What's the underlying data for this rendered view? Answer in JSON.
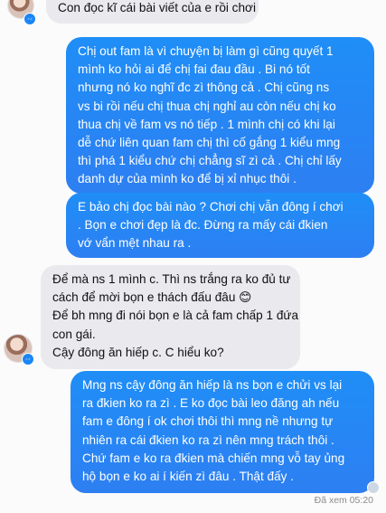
{
  "messages": [
    {
      "sender": "them",
      "lines": [
        "Con đọc kĩ cái bài viết của e rồi chơi"
      ]
    },
    {
      "sender": "me",
      "lines": [
        "Chị out fam là vì chuyện bị làm gì cũng quyết 1",
        "mình ko hỏi ai để chị fai đau đầu . Bi nó tốt",
        "nhưng nó ko nghĩ đc zì thông cả . Chị cũng ns",
        "vs bi rồi nếu chị thua chị nghỉ au còn nếu chị ko",
        "thua chị về fam vs nó tiếp . 1 mình chị có khi lại",
        "dễ chứ liên quan fam chị thì cố gắng 1 kiểu mng",
        "thì phá 1 kiểu chứ chị chẳng sĩ zì cả . Chị chỉ lấy",
        "danh dự của mình ko để bị xỉ nhục thôi ."
      ]
    },
    {
      "sender": "me",
      "lines": [
        "E bảo chị đọc bài nào ? Chơi chị vẫn đông í chơi",
        ". Bọn e chơi đẹp là đc. Đừng ra mấy cái đkien",
        "vớ vẩn mệt nhau ra ."
      ]
    },
    {
      "sender": "them",
      "lines": [
        "Để mà ns 1 mình c. Thì ns trắng ra ko đủ tư",
        "cách để mời bọn e thách đấu đâu 😊",
        "Để bh mng đi nói bọn e là cả fam chấp 1 đứa",
        "con gái.",
        "Cậy đông ăn hiếp c. C hiểu ko?"
      ]
    },
    {
      "sender": "me",
      "lines": [
        "Mng ns cậy đông ăn hiếp là ns bọn e chửi vs lại",
        "ra đkien ko ra zì . E ko đọc bài leo đăng ah nếu",
        "fam e đông í ok chơi thôi thì mng nề nhưng tự",
        "nhiên ra cái đkien ko ra zì nên mng trách thôi .",
        "Chứ fam e ko ra đkien mà chiến mng vỗ tay ủng",
        "hộ bọn e ko ai í kiến zì đâu . Thật đấy ."
      ]
    }
  ],
  "seen": "Đã xem 05:20",
  "colors": {
    "outgoing": "#1f8ef7",
    "incoming": "#e9e9ee",
    "badge": "#1b86f5"
  },
  "icons": {
    "avatar": "avatar",
    "badge": "messenger-icon",
    "read": "read-receipt-icon"
  }
}
